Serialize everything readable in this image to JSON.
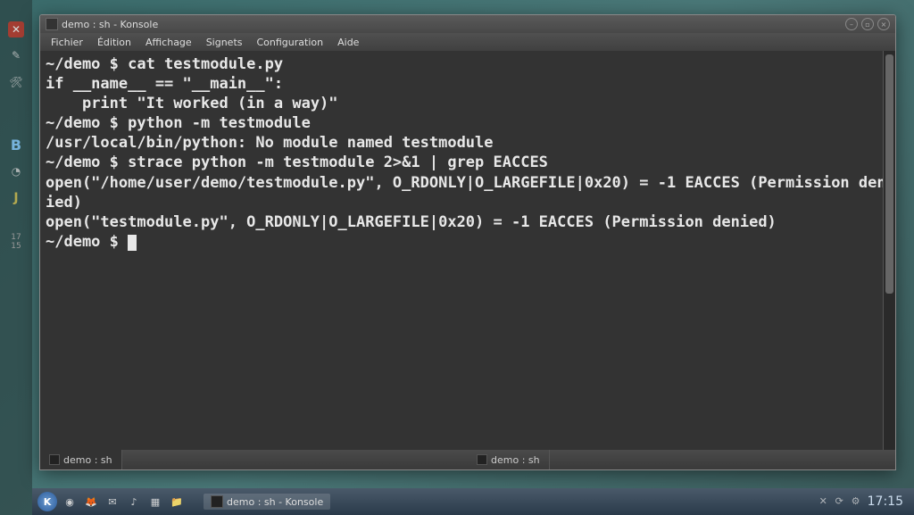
{
  "window": {
    "title": "demo : sh - Konsole",
    "menus": [
      "Fichier",
      "Édition",
      "Affichage",
      "Signets",
      "Configuration",
      "Aide"
    ]
  },
  "dock": {
    "pager_a": "17",
    "pager_b": "15",
    "letter_b": "B",
    "letter_j": "J"
  },
  "terminal": {
    "lines": [
      "~/demo $ cat testmodule.py",
      "if __name__ == \"__main__\":",
      "    print \"It worked (in a way)\"",
      "",
      "",
      "~/demo $ python -m testmodule",
      "/usr/local/bin/python: No module named testmodule",
      "~/demo $ strace python -m testmodule 2>&1 | grep EACCES",
      "open(\"/home/user/demo/testmodule.py\", O_RDONLY|O_LARGEFILE|0x20) = -1 EACCES (Permission denied)",
      "open(\"testmodule.py\", O_RDONLY|O_LARGEFILE|0x20) = -1 EACCES (Permission denied)",
      "~/demo $ "
    ]
  },
  "tabs": [
    {
      "label": "demo : sh",
      "active": true
    },
    {
      "label": "demo : sh",
      "active": false
    }
  ],
  "panel": {
    "task_label": "demo : sh - Konsole",
    "clock": "17:15"
  }
}
